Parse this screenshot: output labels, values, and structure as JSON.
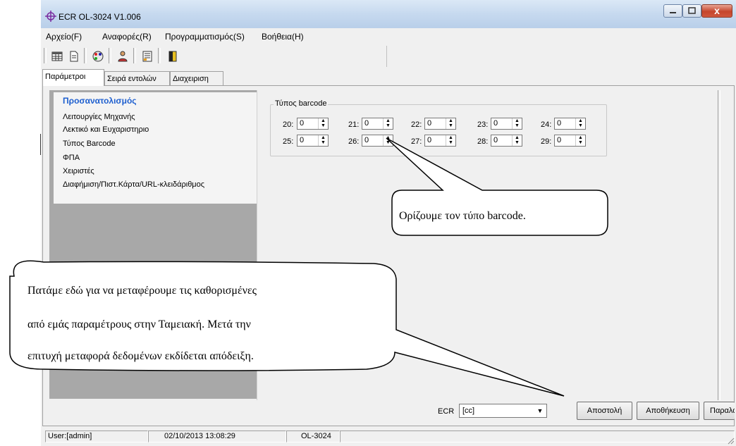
{
  "window": {
    "title": "ECR OL-3024 V1.006",
    "controls": {
      "minimize": "",
      "maximize": "",
      "close": "x"
    }
  },
  "menu": [
    "Αρχείο(F)",
    "Αναφορές(R)",
    "Προγραμματισμός(S)",
    "Βοήθεια(H)"
  ],
  "toolbar_icons": [
    "table-icon",
    "document-icon",
    "palette-icon",
    "users-icon",
    "list-icon",
    "exit-door-icon"
  ],
  "tabs": [
    "Παράμετροι",
    "Σειρά εντολών",
    "Διαχειριση"
  ],
  "nav": {
    "title": "Προσανατολισμός",
    "items": [
      "Λειτουργίες Μηχανής",
      "Λεκτικό και Ευχαριστηριο",
      "Τύπος Barcode",
      "ΦΠΑ",
      "Χειριστές",
      "Διαφήμιση/Πιστ.Κάρτα/URL-κλειδάριθμος"
    ]
  },
  "barcode_group": {
    "legend": "Τύπος barcode",
    "fields": [
      {
        "label": "20:",
        "value": "0"
      },
      {
        "label": "21:",
        "value": "0"
      },
      {
        "label": "22:",
        "value": "0"
      },
      {
        "label": "23:",
        "value": "0"
      },
      {
        "label": "24:",
        "value": "0"
      },
      {
        "label": "25:",
        "value": "0"
      },
      {
        "label": "26:",
        "value": "0"
      },
      {
        "label": "27:",
        "value": "0"
      },
      {
        "label": "28:",
        "value": "0"
      },
      {
        "label": "29:",
        "value": "0"
      }
    ]
  },
  "ecr": {
    "label": "ECR",
    "value": "[cc]"
  },
  "buttons": {
    "send": "Αποστολή",
    "save": "Αποθήκευση",
    "receive": "Παραλαβή"
  },
  "status": {
    "user": "User:[admin]",
    "datetime": "02/10/2013 13:08:29",
    "model": "OL-3024"
  },
  "callouts": {
    "barcode": "Ορίζουμε τον τύπο barcode.",
    "send": [
      "Πατάμε εδώ για να μεταφέρουμε τις καθορισμένες",
      "από εμάς παραμέτρους στην Ταμειακή. Μετά την",
      "επιτυχή μεταφορά δεδομένων εκδίδεται απόδειξη."
    ]
  },
  "colors": {
    "nav_title": "#1e5fcf",
    "nav_panel": "#a8a8a8",
    "window_bg": "#f0f0f0"
  }
}
